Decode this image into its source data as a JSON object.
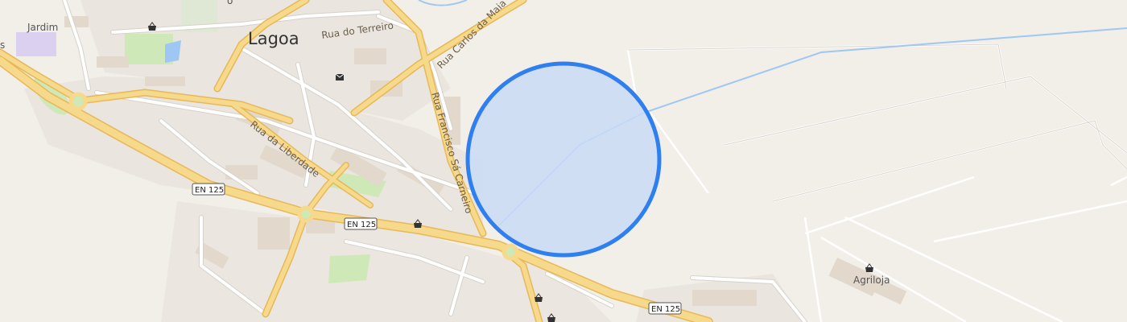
{
  "map": {
    "town_label": "Lagoa",
    "district_labels": {
      "jardim": "Jardim",
      "partial_s": "s",
      "partial_top": "o"
    },
    "street_labels": {
      "rua_do_terreiro": "Rua do Terreiro",
      "rua_carlos_da_maia": "Rua Carlos da Maia",
      "rua_francisco_sa_carneiro": "Rua Francisco Sá Carneiro",
      "rua_da_liberdade": "Rua da Liberdade"
    },
    "road_shields": [
      "EN 125",
      "EN 125",
      "EN 125"
    ],
    "pois": {
      "agriloja": "Agriloja"
    },
    "icons": [
      "shop-basket-icon",
      "post-office-icon",
      "shop-basket-icon",
      "shop-basket-icon",
      "shop-basket-icon",
      "shop-basket-icon"
    ],
    "accuracy_circle": {
      "fill": "#c9daf5",
      "stroke": "#2f7ff0"
    },
    "colors": {
      "background": "#f2efe9",
      "major_road": "#f6d98a",
      "major_road_casing": "#e7b859",
      "minor_road": "#ffffff",
      "minor_casing": "#d6d2c9",
      "water": "#9ec7f3",
      "park": "#cfe8b8",
      "building": "#e4dcd3"
    }
  }
}
